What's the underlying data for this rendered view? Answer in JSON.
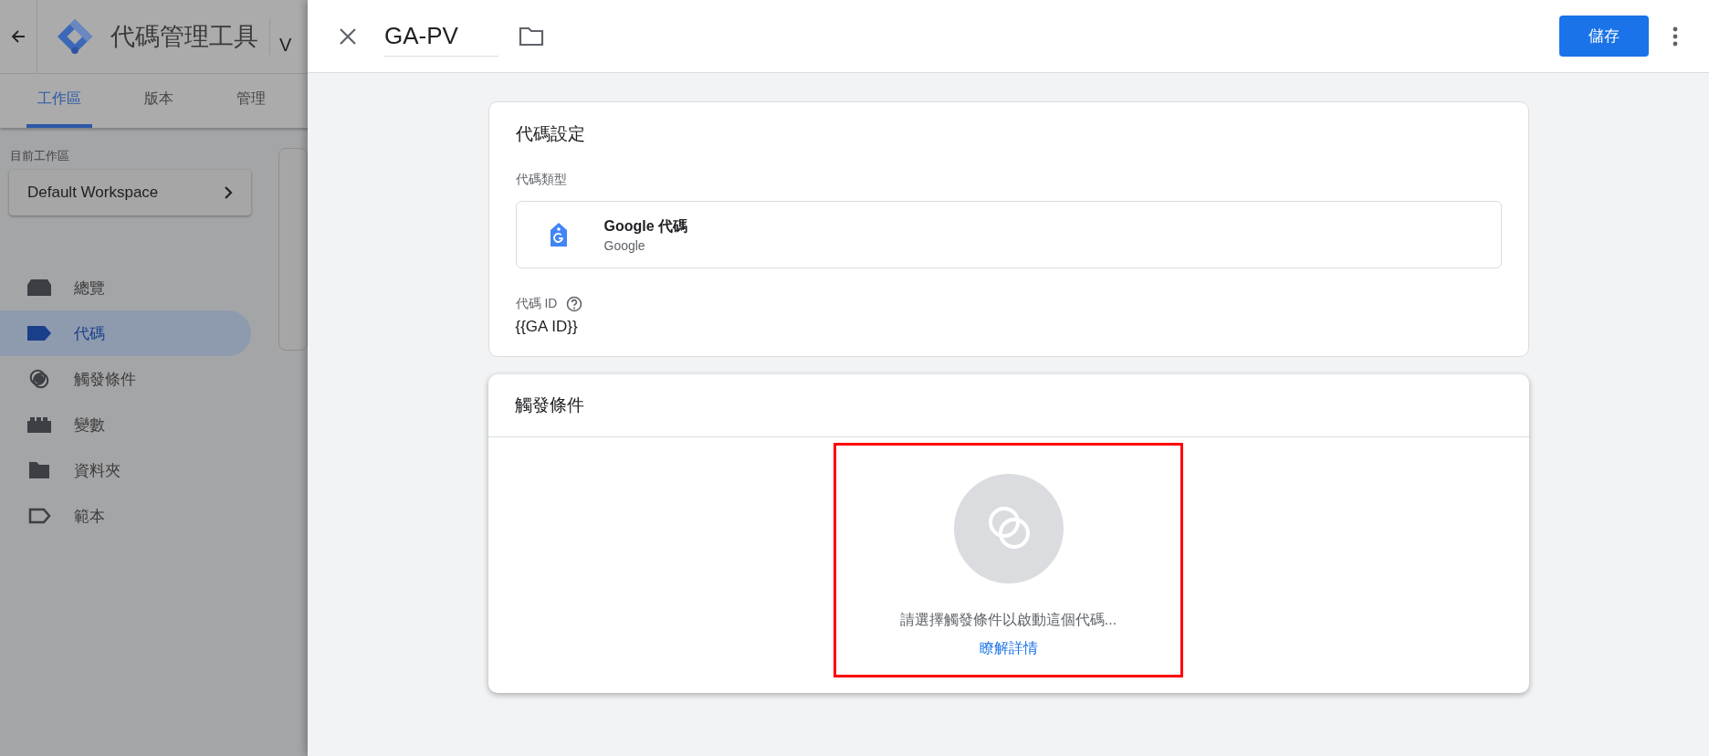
{
  "app": {
    "title": "代碼管理工具",
    "container_fragment": "V"
  },
  "tabs": [
    {
      "label": "工作區",
      "selected": true
    },
    {
      "label": "版本",
      "selected": false
    },
    {
      "label": "管理",
      "selected": false
    }
  ],
  "workspace": {
    "label": "目前工作區",
    "name": "Default Workspace"
  },
  "nav": [
    {
      "label": "總覽",
      "selected": false
    },
    {
      "label": "代碼",
      "selected": true
    },
    {
      "label": "觸發條件",
      "selected": false
    },
    {
      "label": "變數",
      "selected": false
    },
    {
      "label": "資料夾",
      "selected": false
    },
    {
      "label": "範本",
      "selected": false
    }
  ],
  "panel": {
    "title": "GA-PV",
    "save": "儲存"
  },
  "tag_config": {
    "heading": "代碼設定",
    "type_label": "代碼類型",
    "type_name": "Google 代碼",
    "type_vendor": "Google",
    "id_label": "代碼 ID",
    "id_value": "{{GA ID}}"
  },
  "triggering": {
    "heading": "觸發條件",
    "message": "請選擇觸發條件以啟動這個代碼...",
    "link": "瞭解詳情",
    "highlighted": true
  }
}
